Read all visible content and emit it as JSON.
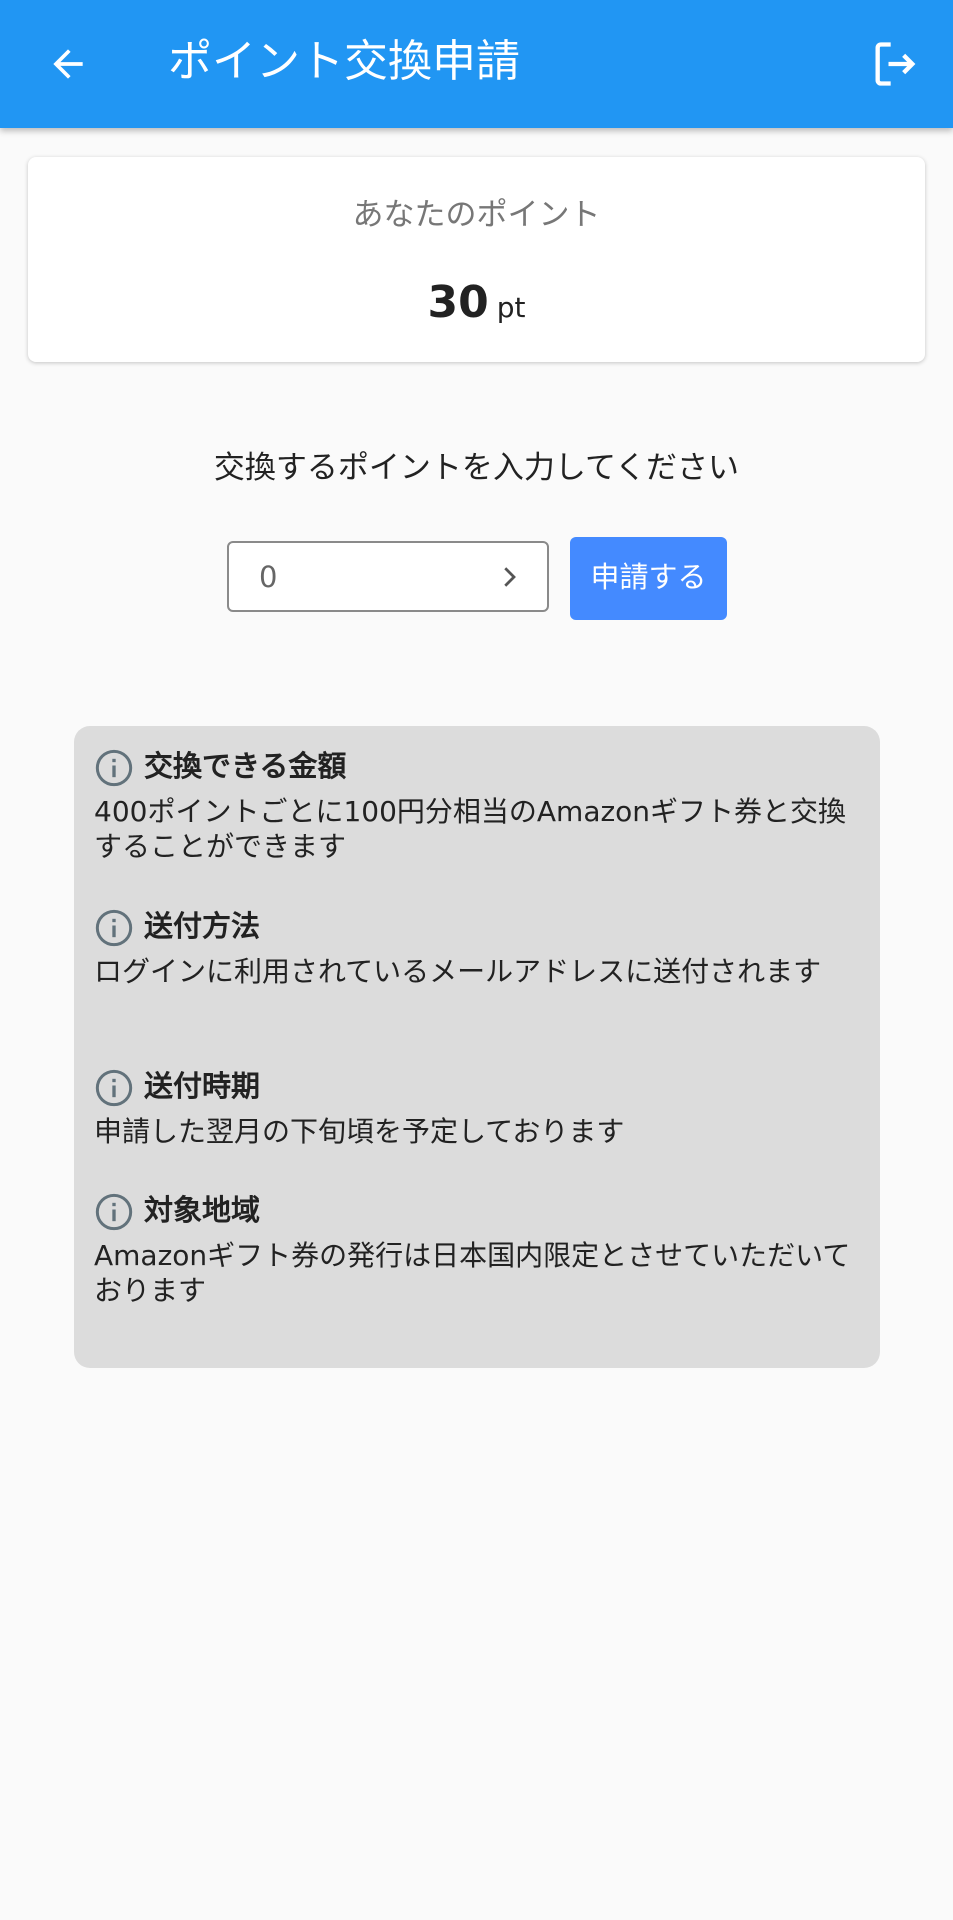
{
  "appbar": {
    "title": "ポイント交換申請",
    "back_icon": "arrow-left-icon",
    "logout_icon": "logout-icon",
    "color": "#2196f3"
  },
  "points_card": {
    "label": "あなたのポイント",
    "value": "30",
    "unit": "pt"
  },
  "exchange": {
    "prompt": "交換するポイントを入力してください",
    "input_value": "0",
    "apply_label": "申請する",
    "button_color": "#448aff"
  },
  "info": {
    "items": [
      {
        "title": "交換できる金額",
        "body": "400ポイントごとに100円分相当のAmazonギフト券と交換することができます",
        "icon": "info-icon"
      },
      {
        "title": "送付方法",
        "body": "ログインに利用されているメールアドレスに送付されます",
        "icon": "info-icon"
      },
      {
        "title": "送付時期",
        "body": "申請した翌月の下旬頃を予定しております",
        "icon": "info-icon"
      },
      {
        "title": "対象地域",
        "body": "Amazonギフト券の発行は日本国内限定とさせていただいております",
        "icon": "info-icon"
      }
    ]
  }
}
